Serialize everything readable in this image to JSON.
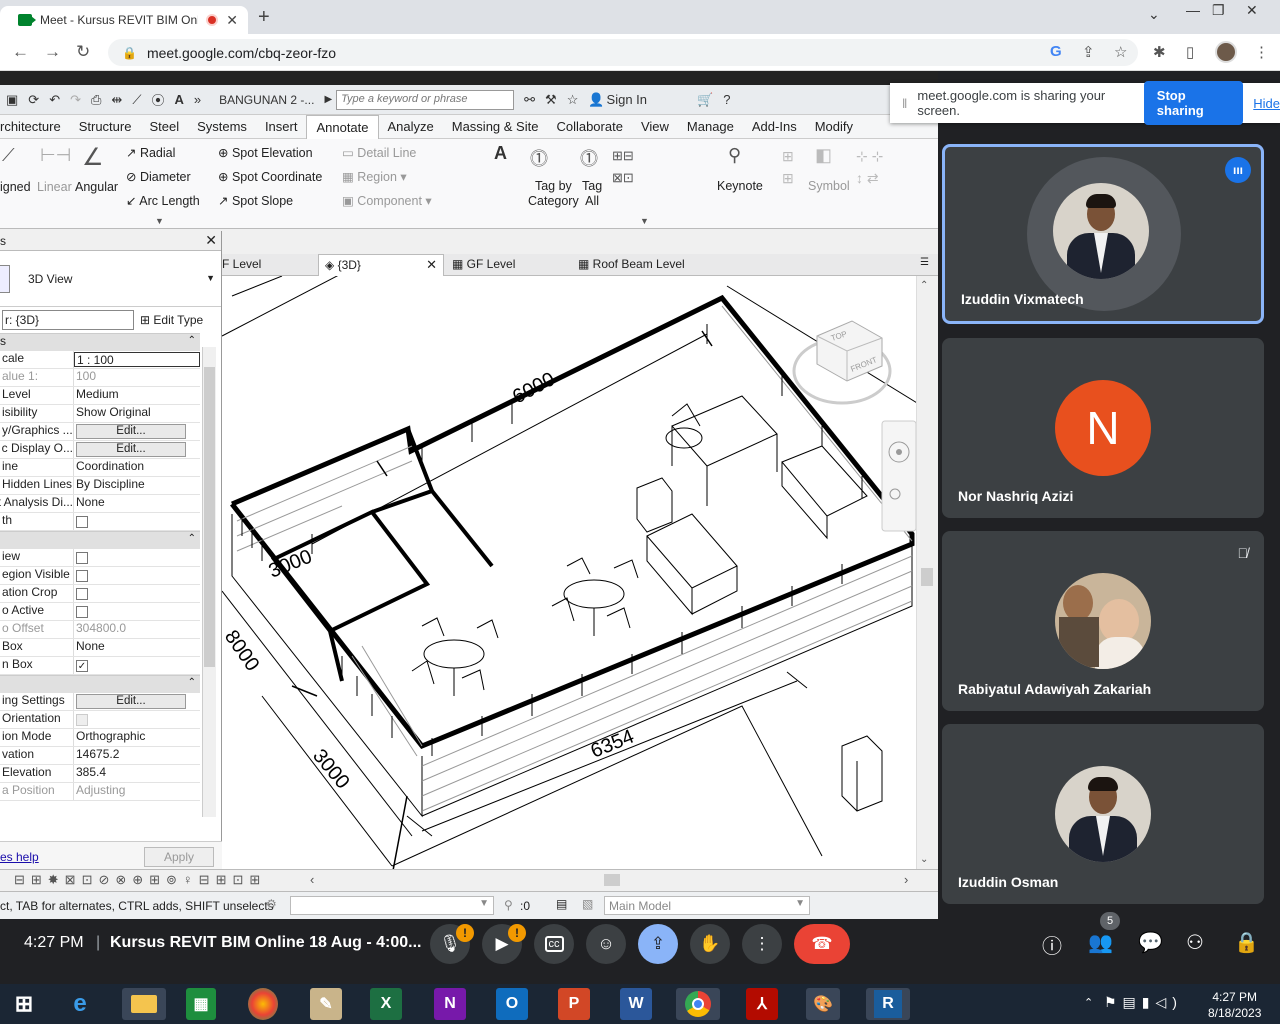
{
  "browser": {
    "tab_title": "Meet - Kursus REVIT BIM Onl",
    "url": "meet.google.com/cbq-zeor-fzo",
    "new_tab": "+"
  },
  "revit": {
    "project_name": "BANGUNAN 2 -...",
    "search_placeholder": "Type a keyword or phrase",
    "sign_in": "Sign In",
    "ribbon_tabs": [
      "rchitecture",
      "Structure",
      "Steel",
      "Systems",
      "Insert",
      "Annotate",
      "Analyze",
      "Massing & Site",
      "Collaborate",
      "View",
      "Manage",
      "Add-Ins",
      "Modify"
    ],
    "active_tab": "Annotate",
    "ribbon": {
      "aligned": "igned",
      "linear": "Linear",
      "angular": "Angular",
      "radial": "Radial",
      "diameter": "Diameter",
      "arc_length": "Arc  Length",
      "spot_elevation": "Spot Elevation",
      "spot_coordinate": "Spot Coordinate",
      "spot_slope": "Spot Slope",
      "detail_line": "Detail  Line",
      "region": "Region",
      "component": "Component",
      "tag_by_category_1": "Tag by",
      "tag_by_category_2": "Category",
      "tag_all_1": "Tag",
      "tag_all_2": "All",
      "keynote": "Keynote",
      "symbol": "Symbol"
    },
    "properties": {
      "header": "s",
      "type_name": "3D View",
      "instance_selector": "r: {3D}",
      "edit_type": "Edit Type",
      "group1": "s",
      "rows1": [
        {
          "k": "cale",
          "v": "1 : 100",
          "style": "input"
        },
        {
          "k": "alue    1:",
          "v": "100",
          "style": "dim"
        },
        {
          "k": "Level",
          "v": "Medium"
        },
        {
          "k": "isibility",
          "v": "Show Original"
        },
        {
          "k": "y/Graphics ...",
          "v": "Edit...",
          "style": "button"
        },
        {
          "k": "c Display O...",
          "v": "Edit...",
          "style": "button"
        },
        {
          "k": "ine",
          "v": "Coordination"
        },
        {
          "k": "Hidden Lines",
          "v": "By Discipline"
        },
        {
          "k": "t Analysis Di...",
          "v": "None"
        },
        {
          "k": "th",
          "v": "",
          "style": "check"
        }
      ],
      "rows2": [
        {
          "k": "iew",
          "v": "",
          "style": "check"
        },
        {
          "k": "egion Visible",
          "v": "",
          "style": "check"
        },
        {
          "k": "ation Crop",
          "v": "",
          "style": "check"
        },
        {
          "k": "o Active",
          "v": "",
          "style": "check"
        },
        {
          "k": "o Offset",
          "v": "304800.0",
          "style": "dim"
        },
        {
          "k": "Box",
          "v": "None"
        },
        {
          "k": "n Box",
          "v": "✓",
          "style": "checked"
        }
      ],
      "rows3": [
        {
          "k": "ing Settings",
          "v": "Edit...",
          "style": "button"
        },
        {
          "k": "Orientation",
          "v": "",
          "style": "dimcheck"
        },
        {
          "k": "ion Mode",
          "v": "Orthographic"
        },
        {
          "k": "vation",
          "v": "14675.2"
        },
        {
          "k": "Elevation",
          "v": "385.4"
        },
        {
          "k": "a Position",
          "v": "Adjusting",
          "style": "dim"
        }
      ],
      "help": "es help",
      "apply": "Apply"
    },
    "view_tabs": [
      "F Level",
      "{3D}",
      "GF Level",
      "Roof Beam Level"
    ],
    "active_view_tab": "{3D}",
    "dimensions": {
      "d6000": "6000",
      "d3000a": "3000",
      "d3000b": "3000",
      "d6354": "6354",
      "d8000": "8000"
    },
    "viewcube": {
      "top": "TOP",
      "front": "FRONT"
    },
    "status_text": "ct, TAB for alternates, CTRL adds, SHIFT unselects",
    "workset_count": ":0",
    "model_selector": "Main Model"
  },
  "meet": {
    "sharing_text": "meet.google.com is sharing your screen.",
    "stop_sharing": "Stop sharing",
    "hide": "Hide",
    "participants": [
      {
        "name": "Izuddin Vixmatech",
        "type": "photo",
        "speaking": true
      },
      {
        "name": "Nor Nashriq Azizi",
        "type": "initial",
        "initial": "N",
        "color": "#e8501e"
      },
      {
        "name": "Rabiyatul Adawiyah Zakariah",
        "type": "photo-child",
        "muted": true
      },
      {
        "name": "Izuddin Osman",
        "type": "photo"
      }
    ],
    "time": "4:27 PM",
    "meeting_title": "Kursus REVIT BIM Online 18 Aug - 4:00...",
    "participant_count": "5",
    "warning": "!"
  },
  "taskbar": {
    "apps": [
      "start",
      "ie",
      "explorer",
      "sheets",
      "chrome-color",
      "notepad",
      "excel",
      "onenote",
      "outlook",
      "powerpoint",
      "word",
      "chrome",
      "acrobat",
      "paint",
      "revit"
    ],
    "app_letters": {
      "excel": "X",
      "onenote": "N",
      "outlook": "O",
      "powerpoint": "P",
      "word": "W",
      "revit": "R"
    },
    "clock_time": "4:27 PM",
    "clock_date": "8/18/2023"
  }
}
